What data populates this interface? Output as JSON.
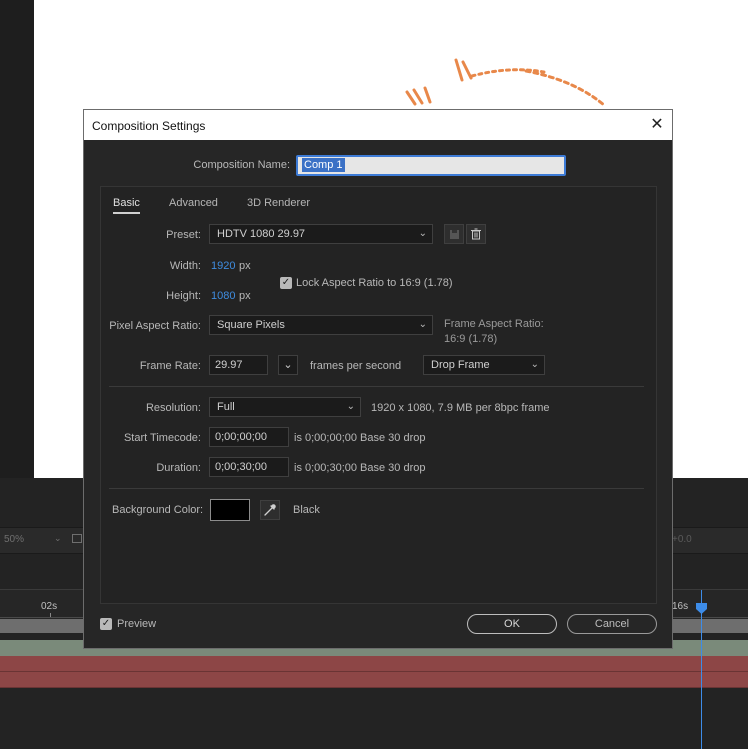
{
  "background": {
    "zoom_level": "50%",
    "exposure_readout": "+0.0",
    "ruler_labels": [
      "02s",
      "16s"
    ],
    "colors": {
      "playhead": "#3d8ce8",
      "canvas": "#ffffff",
      "orange_artwork": "#e8884a"
    }
  },
  "dialog": {
    "title": "Composition Settings",
    "comp_name_label": "Composition Name:",
    "comp_name_value": "Comp 1",
    "tabs": [
      "Basic",
      "Advanced",
      "3D Renderer"
    ],
    "active_tab": "Basic",
    "preset_label": "Preset:",
    "preset_value": "HDTV 1080 29.97",
    "width_label": "Width:",
    "width_value": "1920",
    "height_label": "Height:",
    "height_value": "1080",
    "unit_px": "px",
    "lock_aspect_label": "Lock Aspect Ratio to 16:9 (1.78)",
    "lock_aspect_checked": true,
    "par_label": "Pixel Aspect Ratio:",
    "par_value": "Square Pixels",
    "frame_aspect_label": "Frame Aspect Ratio:",
    "frame_aspect_value": "16:9 (1.78)",
    "frame_rate_label": "Frame Rate:",
    "frame_rate_value": "29.97",
    "frames_per_second": "frames per second",
    "drop_frame_value": "Drop Frame",
    "resolution_label": "Resolution:",
    "resolution_value": "Full",
    "resolution_info": "1920 x 1080, 7.9 MB per 8bpc frame",
    "start_tc_label": "Start Timecode:",
    "start_tc_value": "0;00;00;00",
    "start_tc_info": "is 0;00;00;00  Base 30  drop",
    "duration_label": "Duration:",
    "duration_value": "0;00;30;00",
    "duration_info": "is 0;00;30;00  Base 30  drop",
    "bg_color_label": "Background Color:",
    "bg_color_name": "Black",
    "bg_color_hex": "#000000",
    "preview_label": "Preview",
    "preview_checked": true,
    "ok_label": "OK",
    "cancel_label": "Cancel",
    "icons": [
      "save-preset-icon",
      "trash-icon",
      "eyedropper-icon",
      "close-icon",
      "checkmark-icon",
      "chevron-down-icon"
    ]
  }
}
